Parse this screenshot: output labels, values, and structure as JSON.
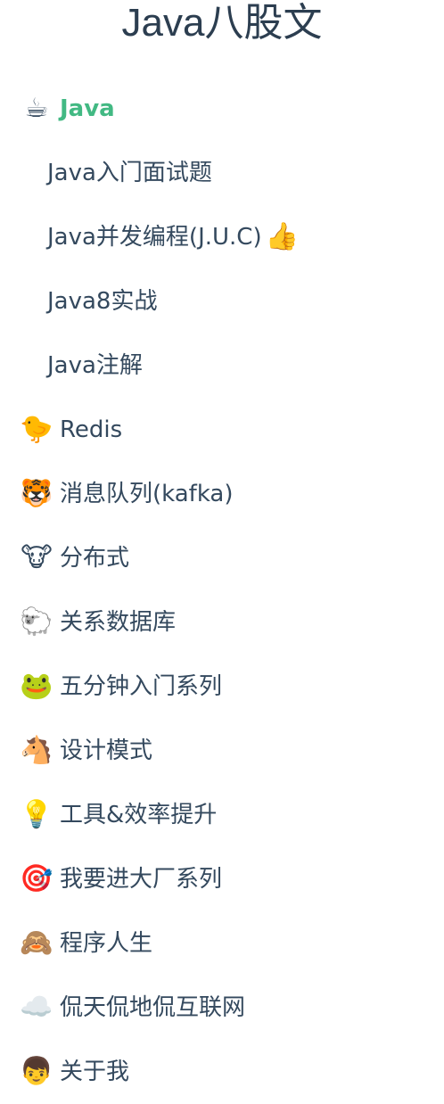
{
  "sidebar": {
    "title": "Java八股文",
    "active_color": "#42b983",
    "text_color": "#34495e",
    "items": [
      {
        "icon": "hot-beverage-icon",
        "emoji": "☕",
        "label": "Java",
        "active": true
      },
      {
        "label": "Java入门面试题"
      },
      {
        "label": "Java并发编程(J.U.C)",
        "suffix_icon": "thumbs-up-icon",
        "suffix_emoji": "👍"
      },
      {
        "label": "Java8实战"
      },
      {
        "label": "Java注解"
      },
      {
        "icon": "chick-icon",
        "emoji": "🐤",
        "label": "Redis"
      },
      {
        "icon": "tiger-face-icon",
        "emoji": "🐯",
        "label": "消息队列(kafka)"
      },
      {
        "icon": "cow-face-icon",
        "emoji": "🐮",
        "label": "分布式"
      },
      {
        "icon": "sheep-icon",
        "emoji": "🐑",
        "label": "关系数据库"
      },
      {
        "icon": "frog-face-icon",
        "emoji": "🐸",
        "label": "五分钟入门系列"
      },
      {
        "icon": "horse-face-icon",
        "emoji": "🐴",
        "label": "设计模式"
      },
      {
        "icon": "light-bulb-icon",
        "emoji": "💡",
        "label": "工具&效率提升"
      },
      {
        "icon": "target-icon",
        "emoji": "🎯",
        "label": "我要进大厂系列"
      },
      {
        "icon": "see-no-evil-monkey-icon",
        "emoji": "🙈",
        "label": "程序人生"
      },
      {
        "icon": "cloud-icon",
        "emoji": "☁️",
        "label": "侃天侃地侃互联网"
      },
      {
        "icon": "boy-icon",
        "emoji": "👦",
        "label": "关于我"
      }
    ]
  }
}
